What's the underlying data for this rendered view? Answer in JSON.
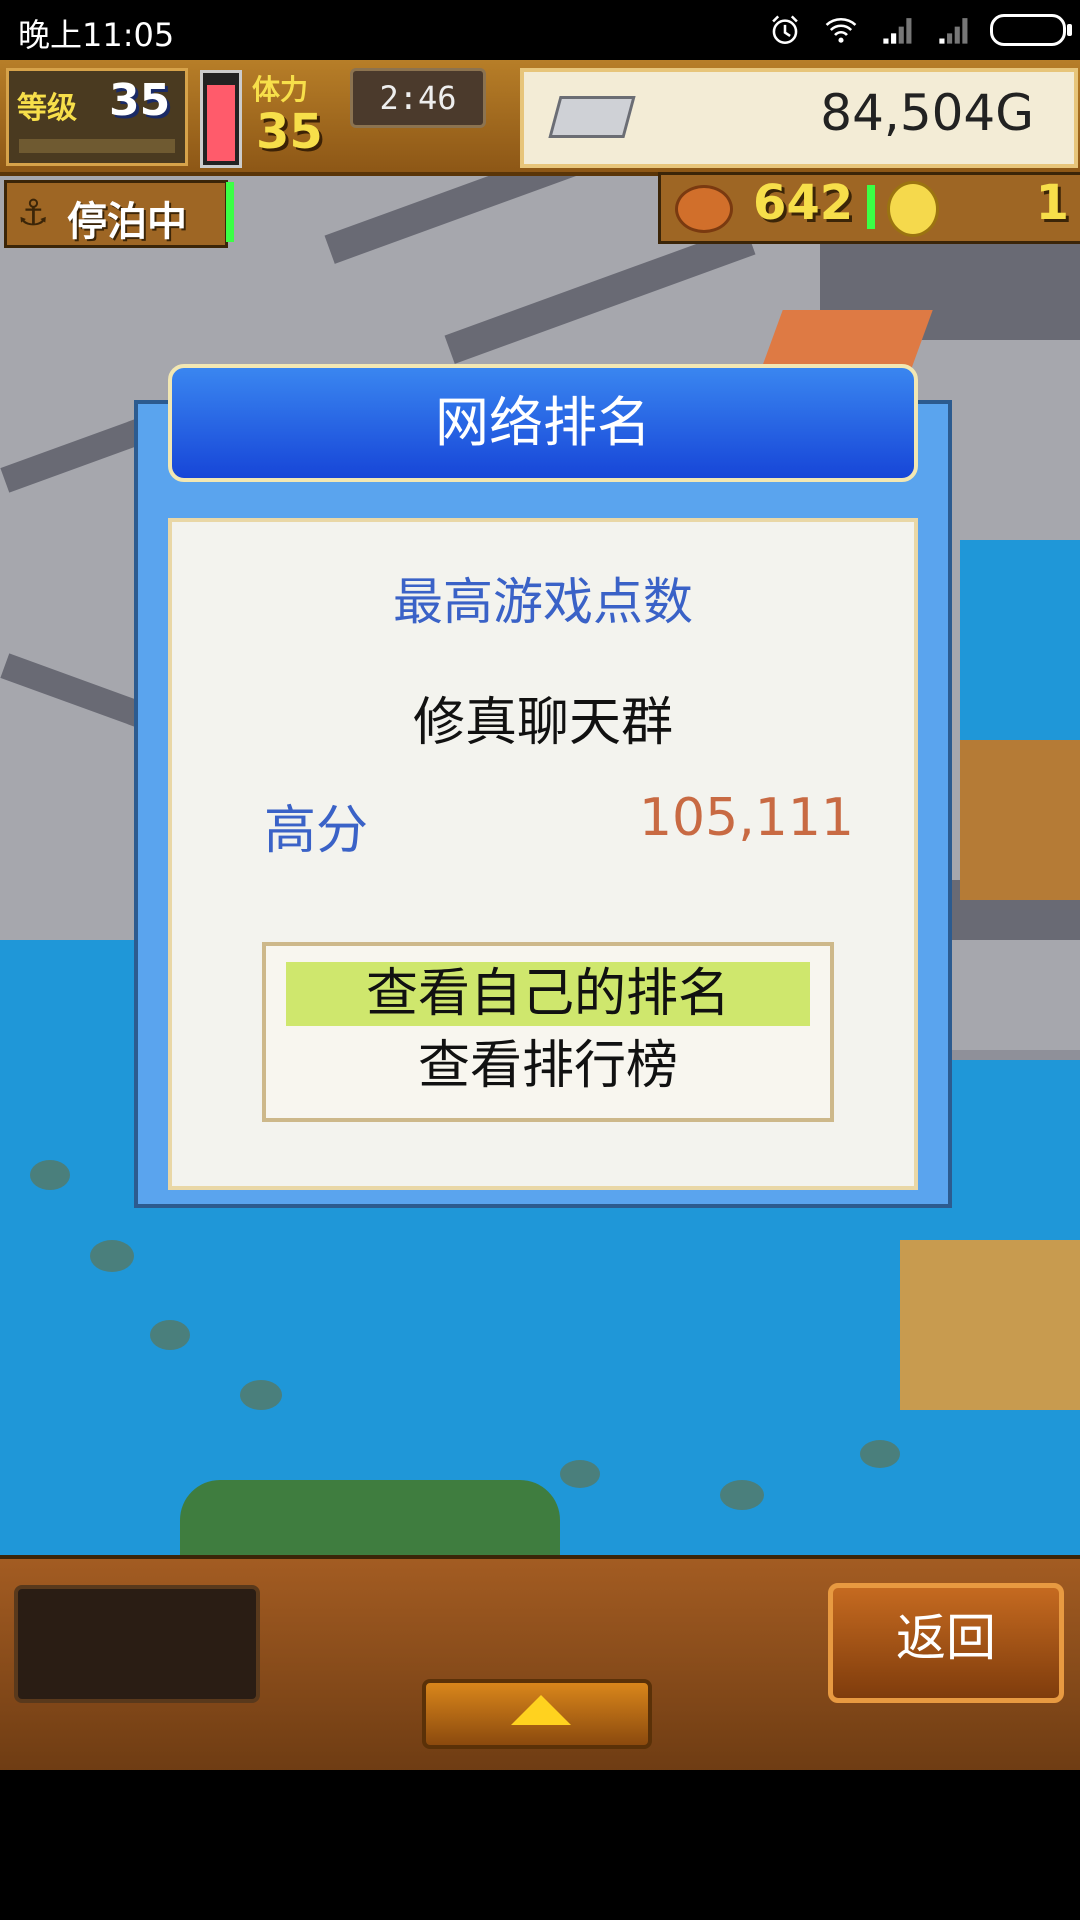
{
  "status_bar": {
    "time": "晚上11:05",
    "icons": [
      "alarm-icon",
      "wifi-icon",
      "signal-icon",
      "signal-icon",
      "battery-icon"
    ]
  },
  "hud": {
    "level_label": "等级",
    "level_value": "35",
    "stamina_label": "体力",
    "stamina_value": "35",
    "timer": "2:46",
    "gold": "84,504G",
    "dock_status": "停泊中",
    "food": "642",
    "medals": "1"
  },
  "dialog": {
    "title": "网络排名",
    "heading": "最高游戏点数",
    "name": "修真聊天群",
    "score_label": "高分",
    "score_value": "105,111",
    "menu": [
      {
        "label": "查看自己的排名",
        "selected": true
      },
      {
        "label": "查看排行榜",
        "selected": false
      }
    ]
  },
  "bottom_bar": {
    "back_label": "返回"
  },
  "colors": {
    "title_blue": "#1746d8",
    "heading_blue": "#3a62c7",
    "score_orange": "#c86a43",
    "selection_green": "#cfe76d",
    "sea_blue": "#1f97d8"
  }
}
